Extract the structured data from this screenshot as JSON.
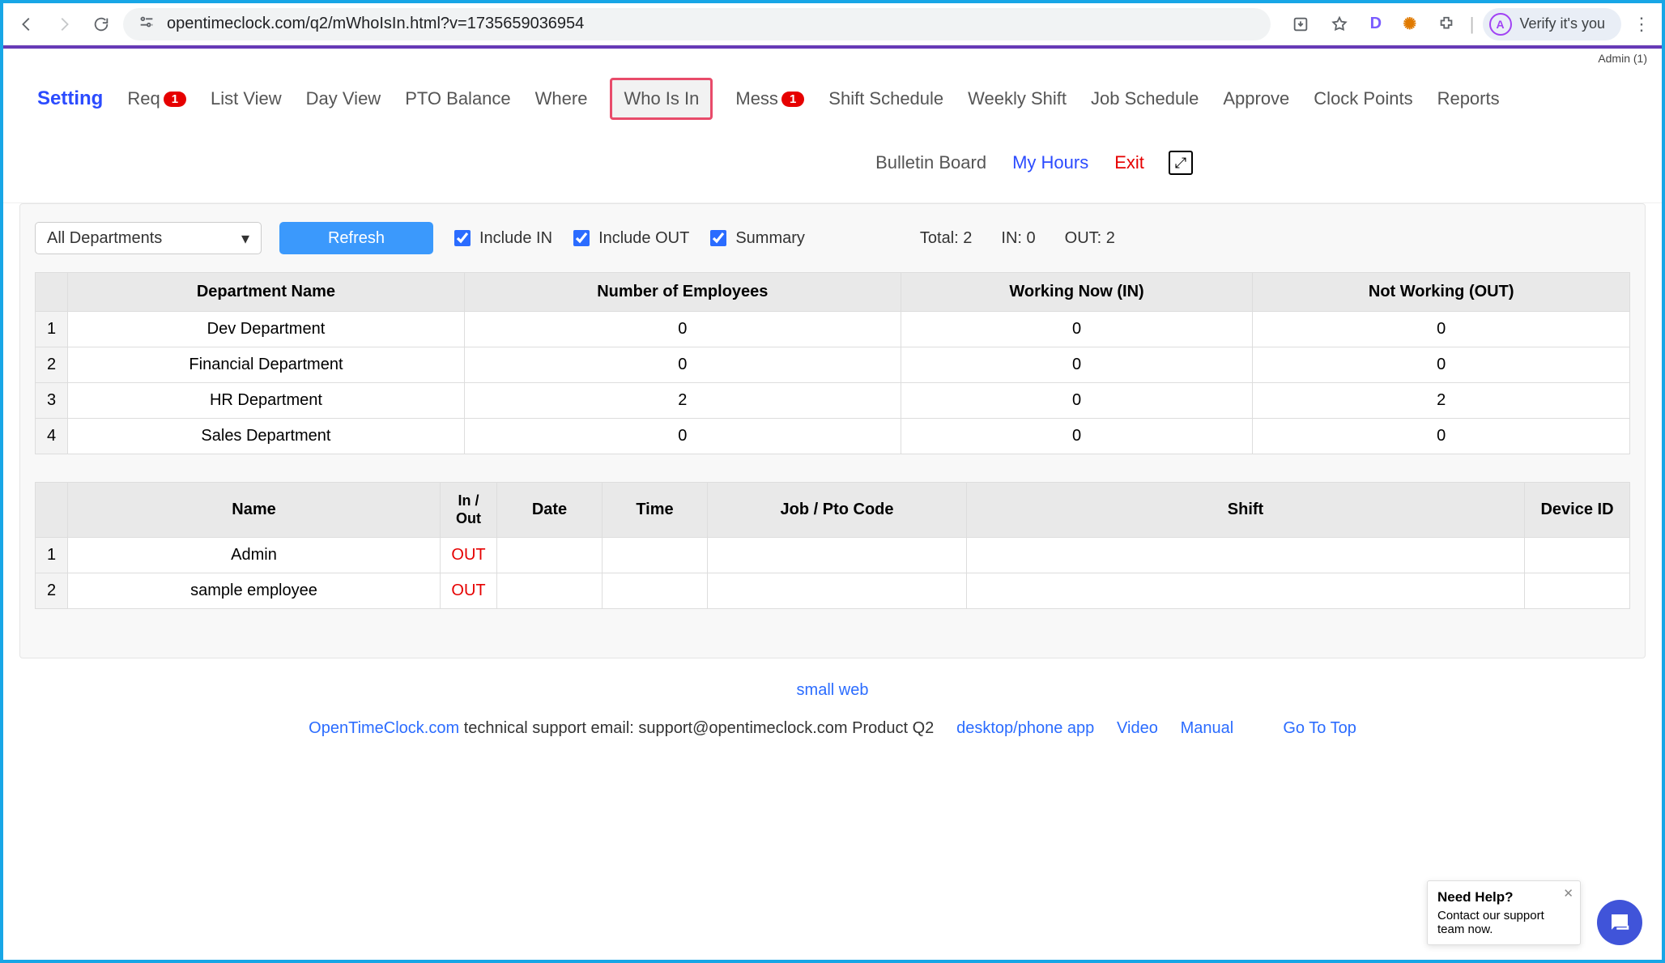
{
  "browser": {
    "url": "opentimeclock.com/q2/mWhoIsIn.html?v=1735659036954",
    "verify_label": "Verify it's you",
    "ext_d": "D"
  },
  "admin_tag": "Admin (1)",
  "nav": {
    "setting": "Setting",
    "req": "Req",
    "req_badge": "1",
    "list_view": "List View",
    "day_view": "Day View",
    "pto_balance": "PTO Balance",
    "where": "Where",
    "who_is_in": "Who Is In",
    "mess": "Mess",
    "mess_badge": "1",
    "shift_schedule": "Shift Schedule",
    "weekly_shift": "Weekly Shift",
    "job_schedule": "Job Schedule",
    "approve": "Approve",
    "clock_points": "Clock Points",
    "reports": "Reports",
    "bulletin_board": "Bulletin Board",
    "my_hours": "My Hours",
    "exit": "Exit"
  },
  "controls": {
    "dept_selected": "All Departments",
    "refresh": "Refresh",
    "include_in": "Include IN",
    "include_out": "Include OUT",
    "summary": "Summary"
  },
  "stats": {
    "total_label": "Total:",
    "total_value": "2",
    "in_label": "IN:",
    "in_value": "0",
    "out_label": "OUT:",
    "out_value": "2"
  },
  "summary_table": {
    "headers": {
      "dept": "Department Name",
      "num": "Number of Employees",
      "in": "Working Now (IN)",
      "out": "Not Working (OUT)"
    },
    "rows": [
      {
        "idx": "1",
        "dept": "Dev Department",
        "num": "0",
        "in": "0",
        "out": "0"
      },
      {
        "idx": "2",
        "dept": "Financial Department",
        "num": "0",
        "in": "0",
        "out": "0"
      },
      {
        "idx": "3",
        "dept": "HR Department",
        "num": "2",
        "in": "0",
        "out": "2"
      },
      {
        "idx": "4",
        "dept": "Sales Department",
        "num": "0",
        "in": "0",
        "out": "0"
      }
    ]
  },
  "emp_table": {
    "headers": {
      "name": "Name",
      "inout": "In / Out",
      "date": "Date",
      "time": "Time",
      "job": "Job / Pto Code",
      "shift": "Shift",
      "device": "Device ID"
    },
    "rows": [
      {
        "idx": "1",
        "name": "Admin",
        "status": "OUT",
        "date": "",
        "time": "",
        "job": "",
        "shift": "",
        "device": ""
      },
      {
        "idx": "2",
        "name": "sample employee",
        "status": "OUT",
        "date": "",
        "time": "",
        "job": "",
        "shift": "",
        "device": ""
      }
    ]
  },
  "footer": {
    "small_web": "small web",
    "brand": "OpenTimeClock.com",
    "support_text": " technical support email: support@opentimeclock.com Product Q2",
    "desktop": "desktop/phone app",
    "video": "Video",
    "manual": "Manual",
    "gotop": "Go To Top"
  },
  "help": {
    "title": "Need Help?",
    "text": "Contact our support team now."
  }
}
